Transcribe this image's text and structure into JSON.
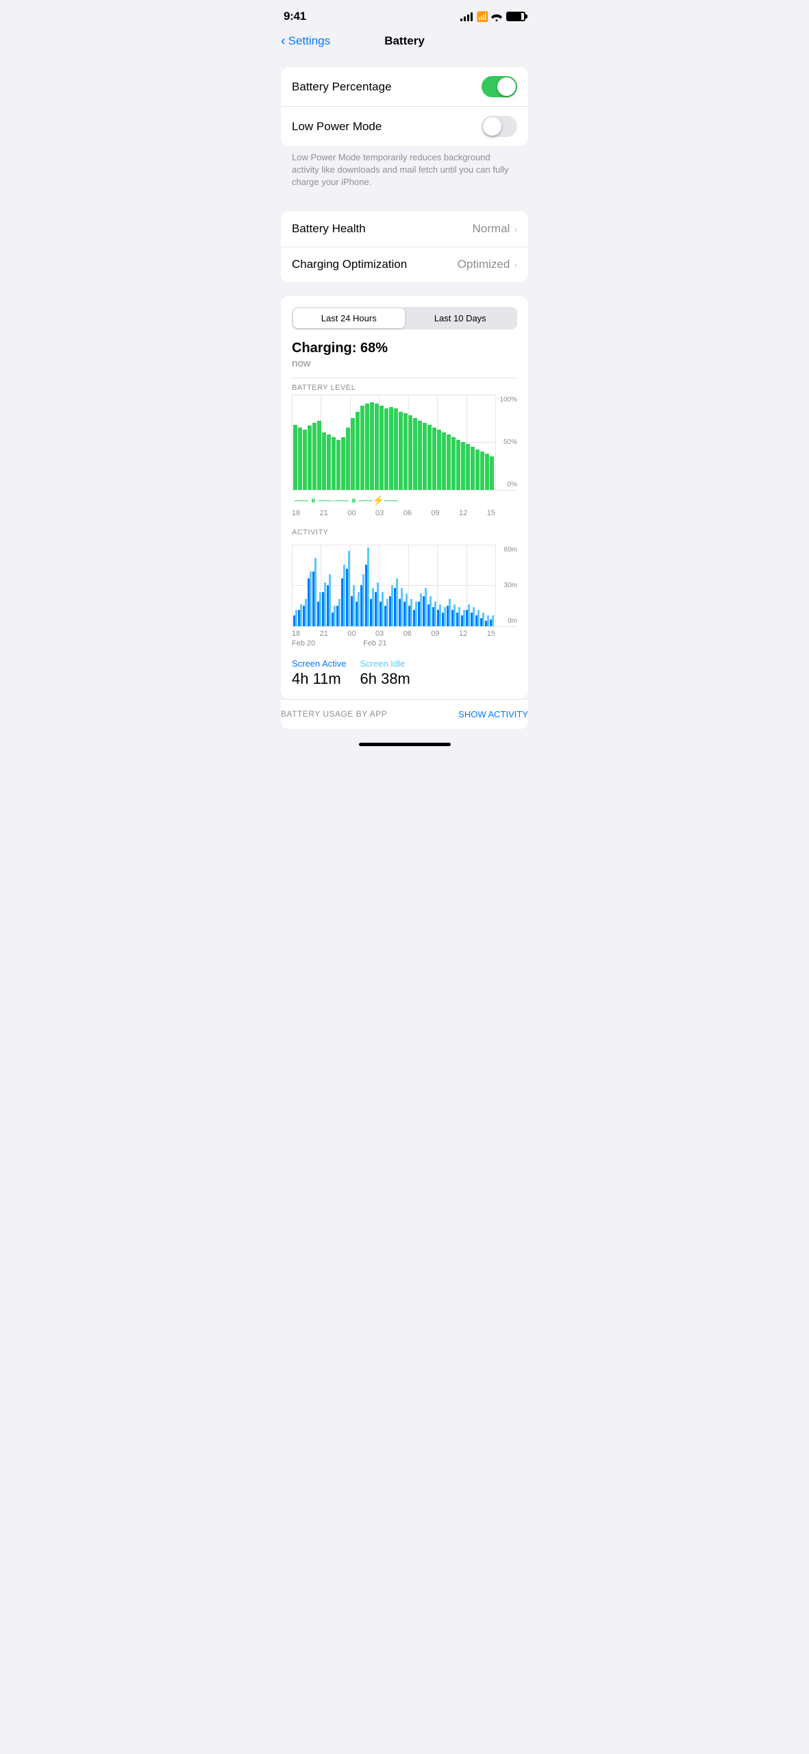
{
  "statusBar": {
    "time": "9:41",
    "batteryLabel": "battery"
  },
  "nav": {
    "backLabel": "Settings",
    "title": "Battery"
  },
  "settings": {
    "group1": {
      "batteryPercentage": {
        "label": "Battery Percentage",
        "toggleOn": true
      },
      "lowPowerMode": {
        "label": "Low Power Mode",
        "toggleOn": false
      }
    },
    "helperText": "Low Power Mode temporarily reduces background activity like downloads and mail fetch until you can fully charge your iPhone.",
    "group2": {
      "batteryHealth": {
        "label": "Battery Health",
        "value": "Normal"
      },
      "chargingOptimization": {
        "label": "Charging Optimization",
        "value": "Optimized"
      }
    }
  },
  "usageCard": {
    "segmentedControl": {
      "option1": "Last 24 Hours",
      "option2": "Last 10 Days",
      "activeIndex": 0
    },
    "chargingTitle": "Charging: 68%",
    "chargingSubtitle": "now",
    "batteryLevelLabel": "BATTERY LEVEL",
    "yLabels": [
      "100%",
      "50%",
      "0%"
    ],
    "xLabels": [
      "18",
      "21",
      "00",
      "03",
      "06",
      "09",
      "12",
      "15"
    ],
    "activityLabel": "ACTIVITY",
    "activityYLabels": [
      "60m",
      "30m",
      "0m"
    ],
    "activityXLabels": [
      "18",
      "21",
      "00",
      "03",
      "06",
      "09",
      "12",
      "15"
    ],
    "activityXSublabels": [
      "Feb 20",
      "",
      "Feb 21",
      "",
      "",
      "",
      "",
      ""
    ],
    "screenActiveLabel": "Screen Active",
    "screenActiveValue": "4h 11m",
    "screenIdleLabel": "Screen Idle",
    "screenIdleValue": "6h 38m",
    "footer": {
      "label": "BATTERY USAGE BY APP",
      "action": "SHOW ACTIVITY"
    }
  },
  "batteryBars": [
    68,
    65,
    63,
    67,
    70,
    72,
    60,
    58,
    55,
    52,
    55,
    65,
    75,
    82,
    88,
    90,
    92,
    90,
    88,
    85,
    87,
    85,
    82,
    80,
    78,
    75,
    72,
    70,
    68,
    65,
    63,
    60,
    58,
    55,
    52,
    50,
    48,
    45,
    42,
    40,
    38,
    35
  ],
  "activityBarsDark": [
    8,
    12,
    15,
    35,
    40,
    18,
    25,
    30,
    10,
    15,
    35,
    42,
    22,
    18,
    30,
    45,
    20,
    25,
    18,
    15,
    22,
    28,
    20,
    18,
    15,
    12,
    18,
    22,
    16,
    14,
    12,
    10,
    15,
    12,
    10,
    8,
    12,
    10,
    8,
    6,
    4,
    5
  ],
  "activityBarsLight": [
    12,
    16,
    20,
    40,
    50,
    25,
    32,
    38,
    15,
    20,
    45,
    55,
    30,
    25,
    38,
    58,
    28,
    32,
    25,
    20,
    30,
    35,
    28,
    24,
    20,
    18,
    24,
    28,
    22,
    18,
    16,
    14,
    20,
    16,
    14,
    12,
    16,
    14,
    12,
    10,
    8,
    8
  ]
}
